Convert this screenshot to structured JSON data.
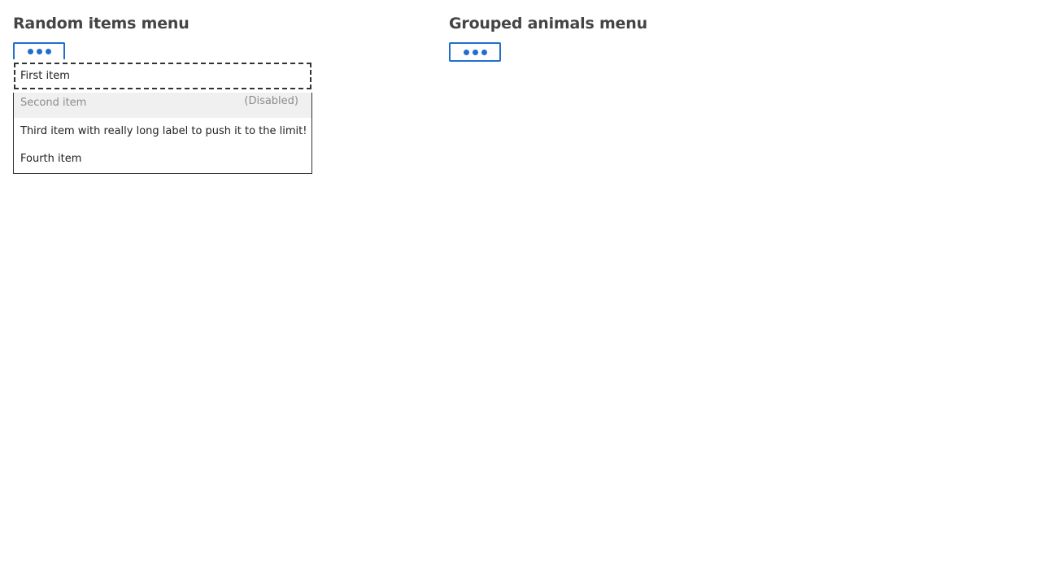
{
  "sections": {
    "random": {
      "title": "Random items menu",
      "button_state": "expanded",
      "items": [
        {
          "label": "First item",
          "state": "focused"
        },
        {
          "label": "Second item",
          "state": "disabled",
          "note": "(Disabled)"
        },
        {
          "label": "Third item with really long label to push it to the limit!",
          "state": "normal"
        },
        {
          "label": "Fourth item",
          "state": "normal"
        }
      ]
    },
    "animals": {
      "title": "Grouped animals menu",
      "button_state": "collapsed"
    }
  },
  "icons": {
    "menu_button": "ellipsis-horizontal-icon"
  },
  "colors": {
    "accent": "#1f6fcc",
    "heading": "#444444",
    "disabled_bg": "#f0f0f0",
    "disabled_text": "#8c8c8c"
  }
}
